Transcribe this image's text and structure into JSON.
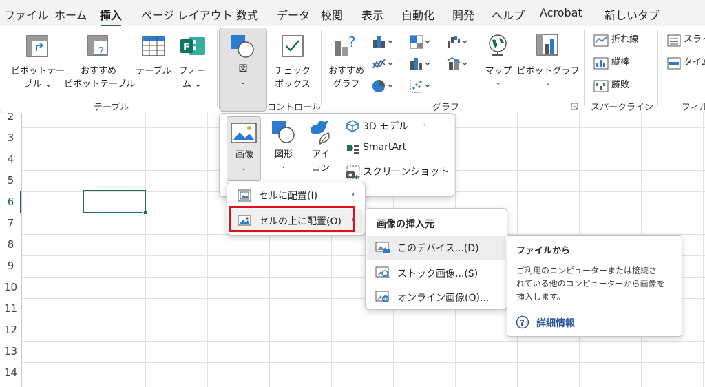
{
  "tabs": [
    {
      "label": "ファイル",
      "active": false
    },
    {
      "label": "ホーム",
      "active": false
    },
    {
      "label": "挿入",
      "active": true
    },
    {
      "label": "ページ レイアウト",
      "active": false
    },
    {
      "label": "数式",
      "active": false
    },
    {
      "label": "データ",
      "active": false
    },
    {
      "label": "校閲",
      "active": false
    },
    {
      "label": "表示",
      "active": false
    },
    {
      "label": "自動化",
      "active": false
    },
    {
      "label": "開発",
      "active": false
    },
    {
      "label": "ヘルプ",
      "active": false
    },
    {
      "label": "Acrobat",
      "active": false
    },
    {
      "label": "新しいタブ",
      "active": false
    }
  ],
  "ribbon": {
    "table_group": {
      "pivot_line1": "ピボットテー",
      "pivot_line2": "ブル ⌄",
      "rec_pivot_line1": "おすすめ",
      "rec_pivot_line2": "ピボットテーブル",
      "table": "テーブル",
      "form_line1": "フォー",
      "form_line2": "ム ⌄",
      "group_label": "テーブル"
    },
    "illustrations": {
      "label": "図",
      "caret": "⌄"
    },
    "controls_group": {
      "checkbox_line1": "チェック",
      "checkbox_line2": "ボックス",
      "group_label": "コントロール"
    },
    "charts_group": {
      "rec_chart_line1": "おすすめ",
      "rec_chart_line2": "グラフ",
      "map": "マップ",
      "pivot_chart": "ピボットグラフ",
      "group_label": "グラフ"
    },
    "sparklines_group": {
      "items": [
        "折れ線",
        "縦棒",
        "勝敗"
      ],
      "group_label": "スパークライン"
    },
    "filter_group": {
      "items": [
        "スライ",
        "タイム"
      ],
      "group_label": "フィル"
    }
  },
  "illustrations_menu": {
    "image": "画像",
    "shapes": "図形",
    "icons_line1": "アイ",
    "icons_line2": "コン",
    "model3d": "3D モデル",
    "smartart": "SmartArt",
    "screenshot": "スクリーンショット"
  },
  "image_menu": {
    "place_in_cell": "セルに配置(I)",
    "place_over_cells": "セルの上に配置(O)"
  },
  "source_menu": {
    "header": "画像の挿入元",
    "items": [
      "このデバイス...(D)",
      "ストック画像...(S)",
      "オンライン画像(O)..."
    ]
  },
  "tooltip": {
    "title": "ファイルから",
    "body_line1": "ご利用のコンピューターまたは接続さ",
    "body_line2": "れている他のコンピューターから画像を",
    "body_line3": "挿入します。",
    "link": "詳細情報"
  },
  "grid": {
    "row_numbers": [
      "2",
      "3",
      "4",
      "5",
      "6",
      "7",
      "8",
      "9",
      "10",
      "11",
      "12",
      "13",
      "14"
    ],
    "selected_row": "6"
  },
  "colors": {
    "accent_green": "#1e7145",
    "highlight_red": "#e0101a",
    "link_blue": "#2b579a"
  }
}
